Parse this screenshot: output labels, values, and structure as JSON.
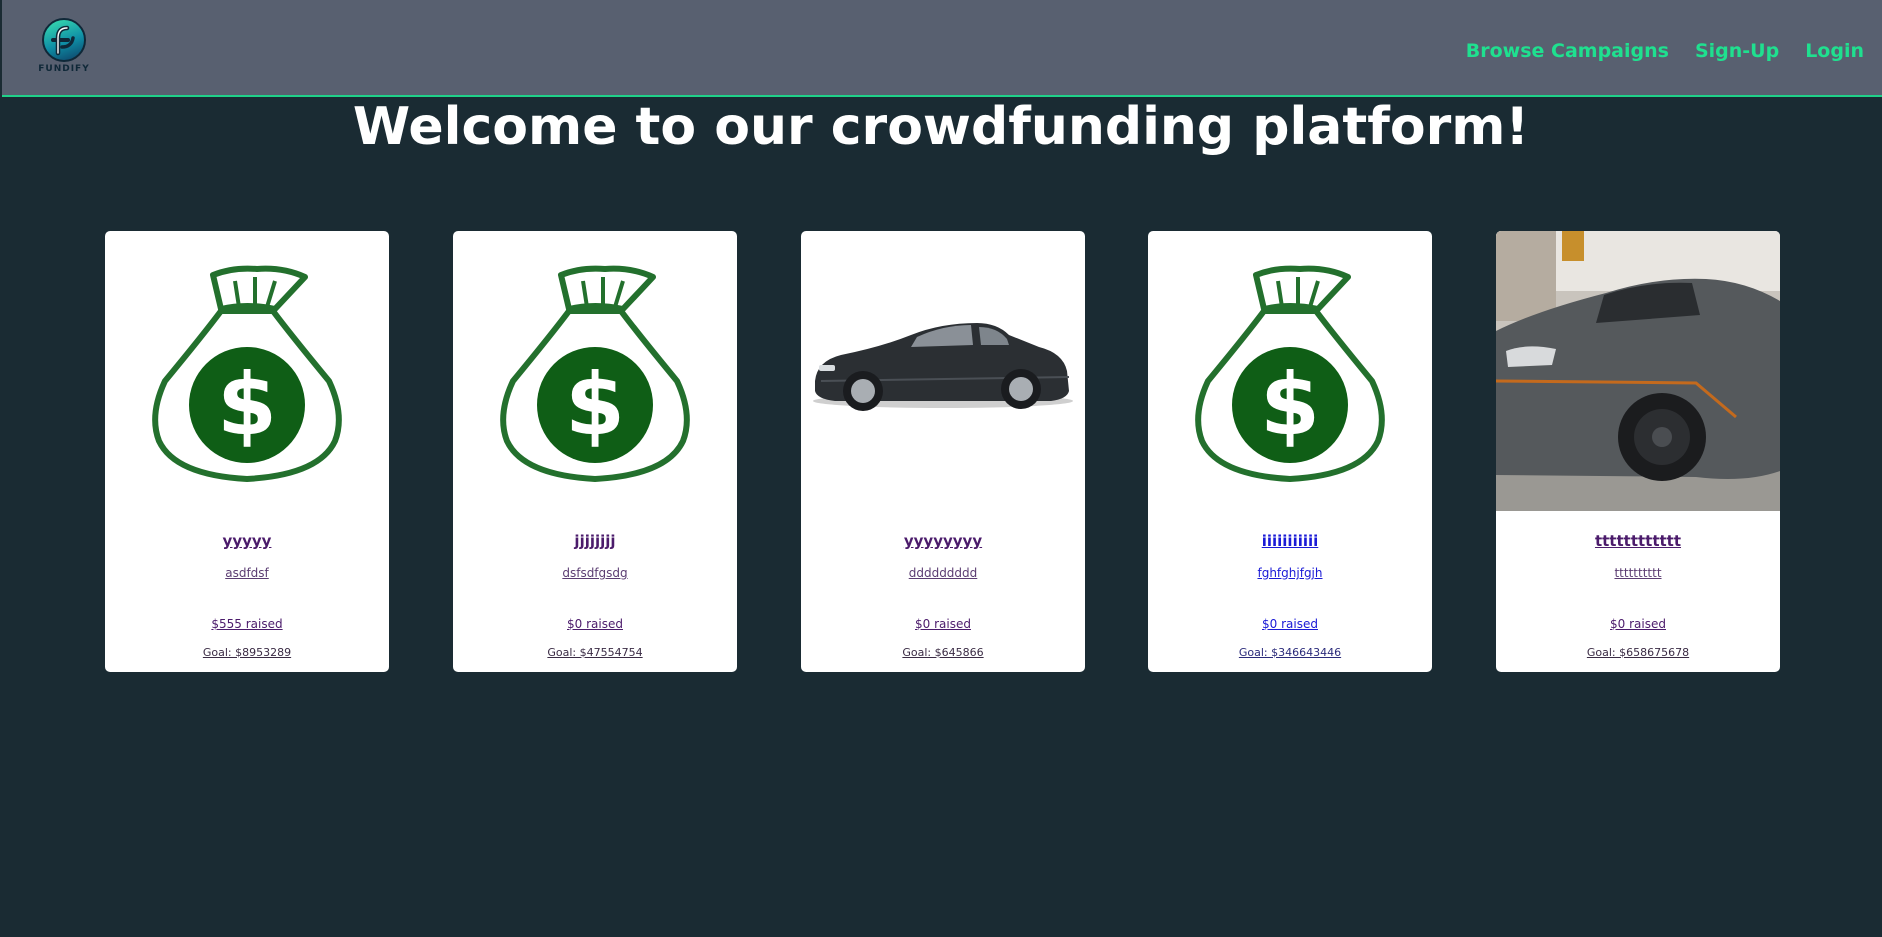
{
  "brand": {
    "logo_text": "FUNDIFY",
    "accent_color": "#1fe08f",
    "icon": "fundify-logo-icon"
  },
  "nav": {
    "links": [
      "Browse Campaigns",
      "Sign-Up",
      "Login"
    ]
  },
  "page": {
    "title": "Welcome to our crowdfunding platform!"
  },
  "campaigns": [
    {
      "name": "yyyyy",
      "description": "asdfdsf",
      "raised": "$555 raised",
      "goal": "Goal: $8953289",
      "image": "money-bag-icon"
    },
    {
      "name": "jjjjjjjj",
      "description": "dsfsdfgsdg",
      "raised": "$0 raised",
      "goal": "Goal: $47554754",
      "image": "money-bag-icon"
    },
    {
      "name": "yyyyyyyy",
      "description": "ddddddddd",
      "raised": "$0 raised",
      "goal": "Goal: $645866",
      "image": "sedan-car-photo"
    },
    {
      "name": "iiiiiiiiiii",
      "description": "fghfghjfgjh",
      "raised": "$0 raised",
      "goal": "Goal: $346643446",
      "image": "money-bag-icon"
    },
    {
      "name": "tttttttttttt",
      "description": "tttttttttt",
      "raised": "$0 raised",
      "goal": "Goal: $658675678",
      "image": "sports-car-photo"
    }
  ]
}
